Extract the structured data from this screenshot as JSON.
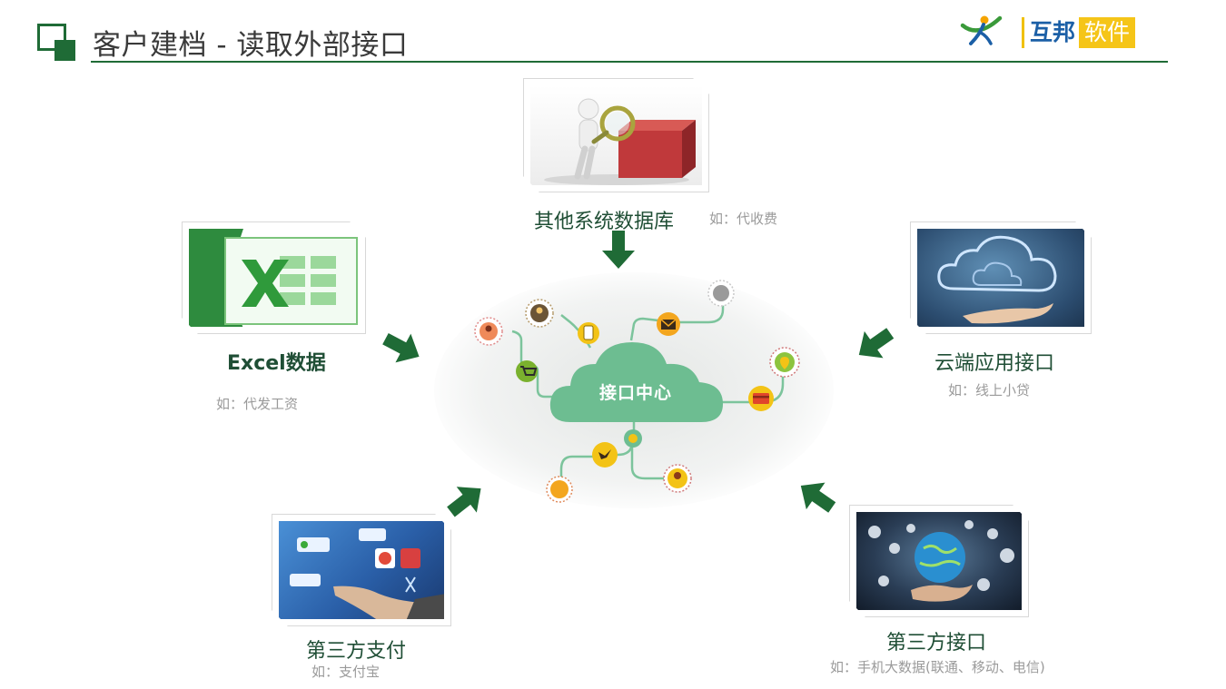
{
  "header": {
    "title": "客户建档 - 读取外部接口",
    "logo": {
      "part1": "互邦",
      "part2": "软件"
    }
  },
  "hub": {
    "label": "接口中心"
  },
  "sources": [
    {
      "name": "其他系统数据库",
      "example": "如：代收费"
    },
    {
      "name": "Excel数据",
      "example": "如：代发工资"
    },
    {
      "name": "云端应用接口",
      "example": "如：线上小贷"
    },
    {
      "name": "第三方支付",
      "example": "如：支付宝"
    },
    {
      "name": "第三方接口",
      "example": "如：手机大数据(联通、移动、电信)"
    }
  ],
  "colors": {
    "brand_green": "#1f6b36",
    "hub_cloud": "#6dbd91",
    "logo_blue": "#1b5fa6",
    "logo_yellow": "#f5c518"
  }
}
